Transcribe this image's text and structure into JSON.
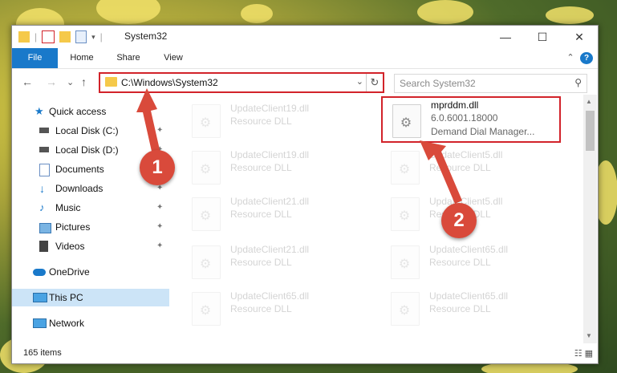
{
  "window": {
    "title": "System32",
    "controls": {
      "minimize": "—",
      "maximize": "☐",
      "close": "✕"
    }
  },
  "ribbon": {
    "tabs": [
      "File",
      "Home",
      "Share",
      "View"
    ],
    "help": "?",
    "expand": "⌃"
  },
  "navigation": {
    "back": "←",
    "forward": "→",
    "recent": "⌄",
    "up": "↑",
    "address_path": "C:\\Windows\\System32",
    "address_dropdown": "⌄",
    "refresh": "↻",
    "search_placeholder": "Search System32",
    "search_icon": "⚲"
  },
  "sidebar": {
    "items": [
      {
        "label": "Quick access",
        "icon": "star-icon",
        "pinned": false
      },
      {
        "label": "Local Disk (C:)",
        "icon": "drive-icon",
        "pinned": true
      },
      {
        "label": "Local Disk (D:)",
        "icon": "drive-icon",
        "pinned": true
      },
      {
        "label": "Documents",
        "icon": "document-icon",
        "pinned": true
      },
      {
        "label": "Downloads",
        "icon": "download-icon",
        "pinned": true
      },
      {
        "label": "Music",
        "icon": "music-icon",
        "pinned": true
      },
      {
        "label": "Pictures",
        "icon": "pictures-icon",
        "pinned": true
      },
      {
        "label": "Videos",
        "icon": "videos-icon",
        "pinned": true
      },
      {
        "label": "OneDrive",
        "icon": "cloud-icon",
        "pinned": false
      },
      {
        "label": "This PC",
        "icon": "computer-icon",
        "pinned": false,
        "selected": true
      },
      {
        "label": "Network",
        "icon": "network-icon",
        "pinned": false
      }
    ],
    "pin_glyph": "📌"
  },
  "files": [
    {
      "name": "UpdateClient19.dll",
      "type": "Resource DLL",
      "faded": true
    },
    {
      "name": "mprddm.dll",
      "version": "6.0.6001.18000",
      "description": "Demand Dial Manager...",
      "faded": false,
      "highlighted": true
    },
    {
      "name": "UpdateClient19.dll",
      "type": "Resource DLL",
      "faded": true
    },
    {
      "name": "UpdateClient5.dll",
      "type": "Resource DLL",
      "faded": true
    },
    {
      "name": "UpdateClient21.dll",
      "type": "Resource DLL",
      "faded": true
    },
    {
      "name": "UpdateClient5.dll",
      "type": "Resource DLL",
      "faded": true
    },
    {
      "name": "UpdateClient21.dll",
      "type": "Resource DLL",
      "faded": true
    },
    {
      "name": "UpdateClient65.dll",
      "type": "Resource DLL",
      "faded": true
    },
    {
      "name": "UpdateClient65.dll",
      "type": "Resource DLL",
      "faded": true
    },
    {
      "name": "UpdateClient65.dll",
      "type": "Resource DLL",
      "faded": true
    }
  ],
  "status": {
    "item_count": "165 items"
  },
  "callouts": [
    "1",
    "2"
  ],
  "colors": {
    "accent": "#1979ca",
    "highlight_border": "#d2232a",
    "callout": "#d94a3b",
    "selected": "#cce4f7"
  }
}
